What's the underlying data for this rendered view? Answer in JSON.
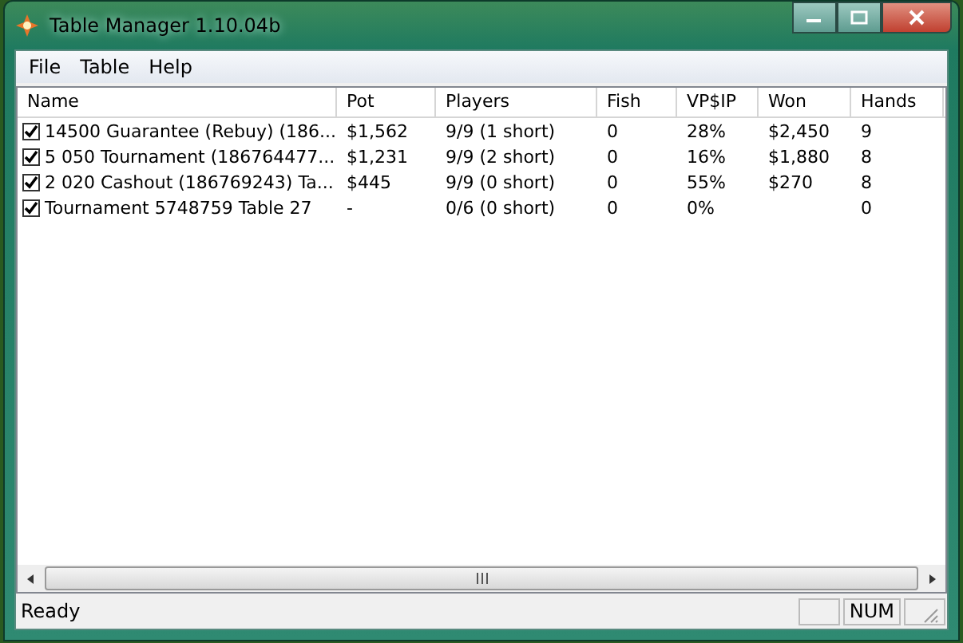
{
  "window": {
    "title": "Table Manager 1.10.04b"
  },
  "menu": [
    "File",
    "Table",
    "Help"
  ],
  "table": {
    "columns": [
      "Name",
      "Pot",
      "Players",
      "Fish",
      "VP$IP",
      "Won",
      "Hands"
    ],
    "rows": [
      {
        "checked": true,
        "cells": [
          "14500 Guarantee (Rebuy) (186...",
          "$1,562",
          "9/9 (1 short)",
          "0",
          "28%",
          "$2,450",
          "9"
        ]
      },
      {
        "checked": true,
        "cells": [
          "5  050 Tournament (186764477...",
          "$1,231",
          "9/9 (2 short)",
          "0",
          "16%",
          "$1,880",
          "8"
        ]
      },
      {
        "checked": true,
        "cells": [
          "2  020 Cashout (186769243) Ta...",
          "$445",
          "9/9 (0 short)",
          "0",
          "55%",
          "$270",
          "8"
        ]
      },
      {
        "checked": true,
        "cells": [
          "Tournament 5748759 Table 27",
          "-",
          "0/6 (0 short)",
          "0",
          "0%",
          "",
          "0"
        ]
      }
    ]
  },
  "status_bar": {
    "text": "Ready",
    "indicators": [
      "NUM"
    ]
  }
}
